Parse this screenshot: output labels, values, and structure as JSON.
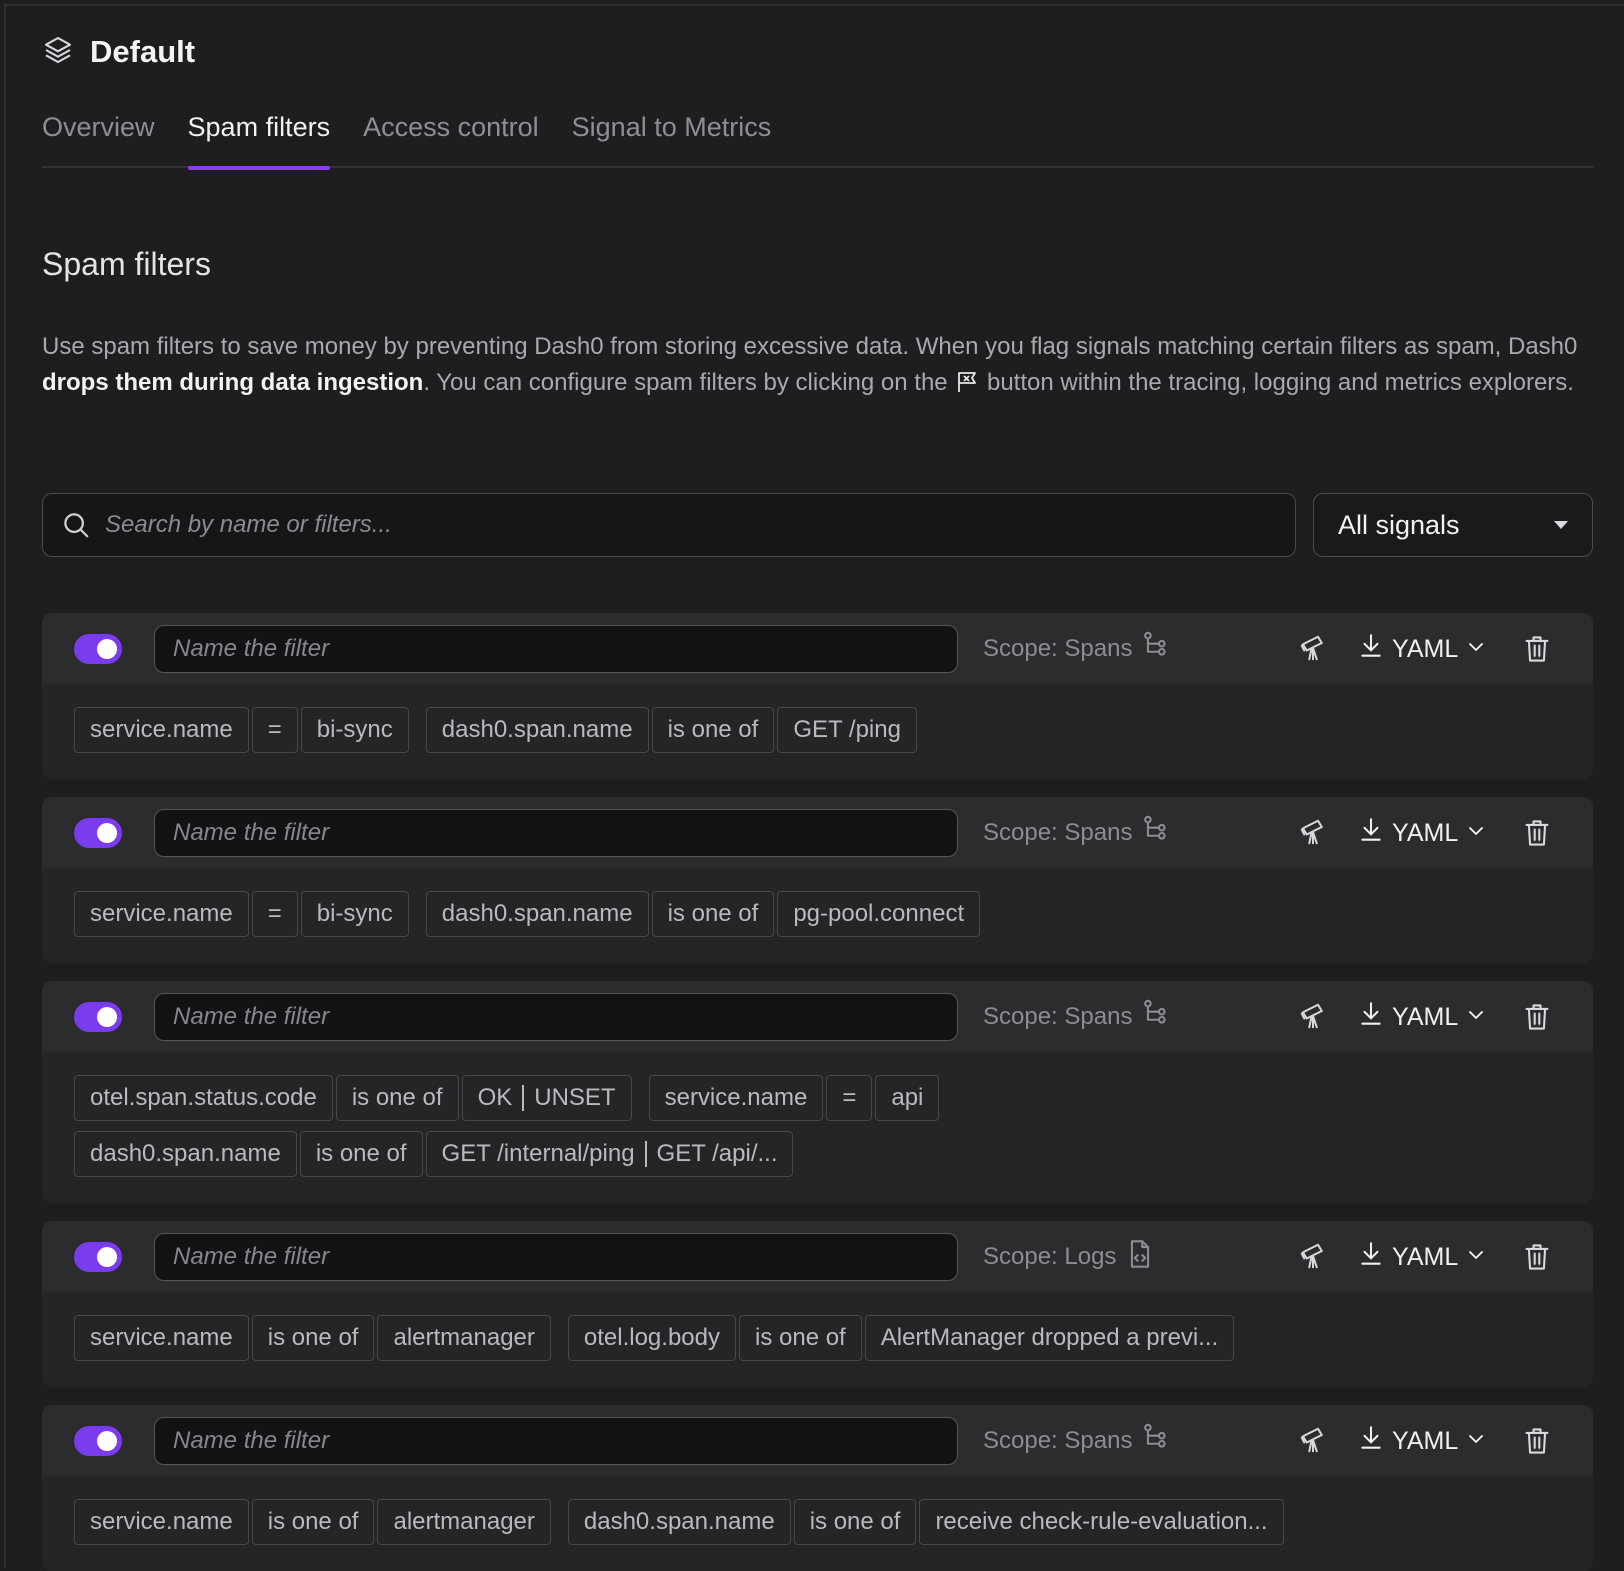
{
  "header": {
    "title": "Default",
    "icon": "layers-icon"
  },
  "tabs": [
    {
      "label": "Overview",
      "active": false
    },
    {
      "label": "Spam filters",
      "active": true
    },
    {
      "label": "Access control",
      "active": false
    },
    {
      "label": "Signal to Metrics",
      "active": false
    }
  ],
  "section": {
    "title": "Spam filters",
    "desc_part1": "Use spam filters to save money by preventing Dash0 from storing excessive data. When you flag signals matching certain filters as spam, Dash0 ",
    "desc_bold": "drops them during data ingestion",
    "desc_part2": ". You can configure spam filters by clicking on the ",
    "desc_part3": " button within the tracing, logging and metrics explorers.",
    "flag_icon": "flag-icon"
  },
  "search": {
    "placeholder": "Search by name or filters...",
    "value": ""
  },
  "signal_select": {
    "value": "All signals"
  },
  "filters": [
    {
      "enabled": true,
      "name_placeholder": "Name the filter",
      "scope": "Scope: Spans",
      "scope_icon": "span-tree-icon",
      "yaml_label": "YAML",
      "conditions": [
        {
          "key": "service.name",
          "op": "=",
          "values": [
            "bi-sync"
          ]
        },
        {
          "key": "dash0.span.name",
          "op": "is one of",
          "values": [
            "GET /ping"
          ]
        }
      ]
    },
    {
      "enabled": true,
      "name_placeholder": "Name the filter",
      "scope": "Scope: Spans",
      "scope_icon": "span-tree-icon",
      "yaml_label": "YAML",
      "conditions": [
        {
          "key": "service.name",
          "op": "=",
          "values": [
            "bi-sync"
          ]
        },
        {
          "key": "dash0.span.name",
          "op": "is one of",
          "values": [
            "pg-pool.connect"
          ]
        }
      ]
    },
    {
      "enabled": true,
      "name_placeholder": "Name the filter",
      "scope": "Scope: Spans",
      "scope_icon": "span-tree-icon",
      "yaml_label": "YAML",
      "conditions": [
        {
          "key": "otel.span.status.code",
          "op": "is one of",
          "values": [
            "OK",
            "UNSET"
          ]
        },
        {
          "key": "service.name",
          "op": "=",
          "values": [
            "api"
          ]
        },
        {
          "key": "dash0.span.name",
          "op": "is one of",
          "values": [
            "GET /internal/ping",
            "GET /api/..."
          ]
        }
      ]
    },
    {
      "enabled": true,
      "name_placeholder": "Name the filter",
      "scope": "Scope: Logs",
      "scope_icon": "log-file-icon",
      "yaml_label": "YAML",
      "conditions": [
        {
          "key": "service.name",
          "op": "is one of",
          "values": [
            "alertmanager"
          ]
        },
        {
          "key": "otel.log.body",
          "op": "is one of",
          "values": [
            "AlertManager dropped a previ..."
          ]
        }
      ]
    },
    {
      "enabled": true,
      "name_placeholder": "Name the filter",
      "scope": "Scope: Spans",
      "scope_icon": "span-tree-icon",
      "yaml_label": "YAML",
      "conditions": [
        {
          "key": "service.name",
          "op": "is one of",
          "values": [
            "alertmanager"
          ]
        },
        {
          "key": "dash0.span.name",
          "op": "is one of",
          "values": [
            "receive check-rule-evaluation..."
          ]
        }
      ]
    }
  ],
  "colors": {
    "accent": "#7b3cf0",
    "background": "#1e1e20",
    "card": "#252528"
  }
}
